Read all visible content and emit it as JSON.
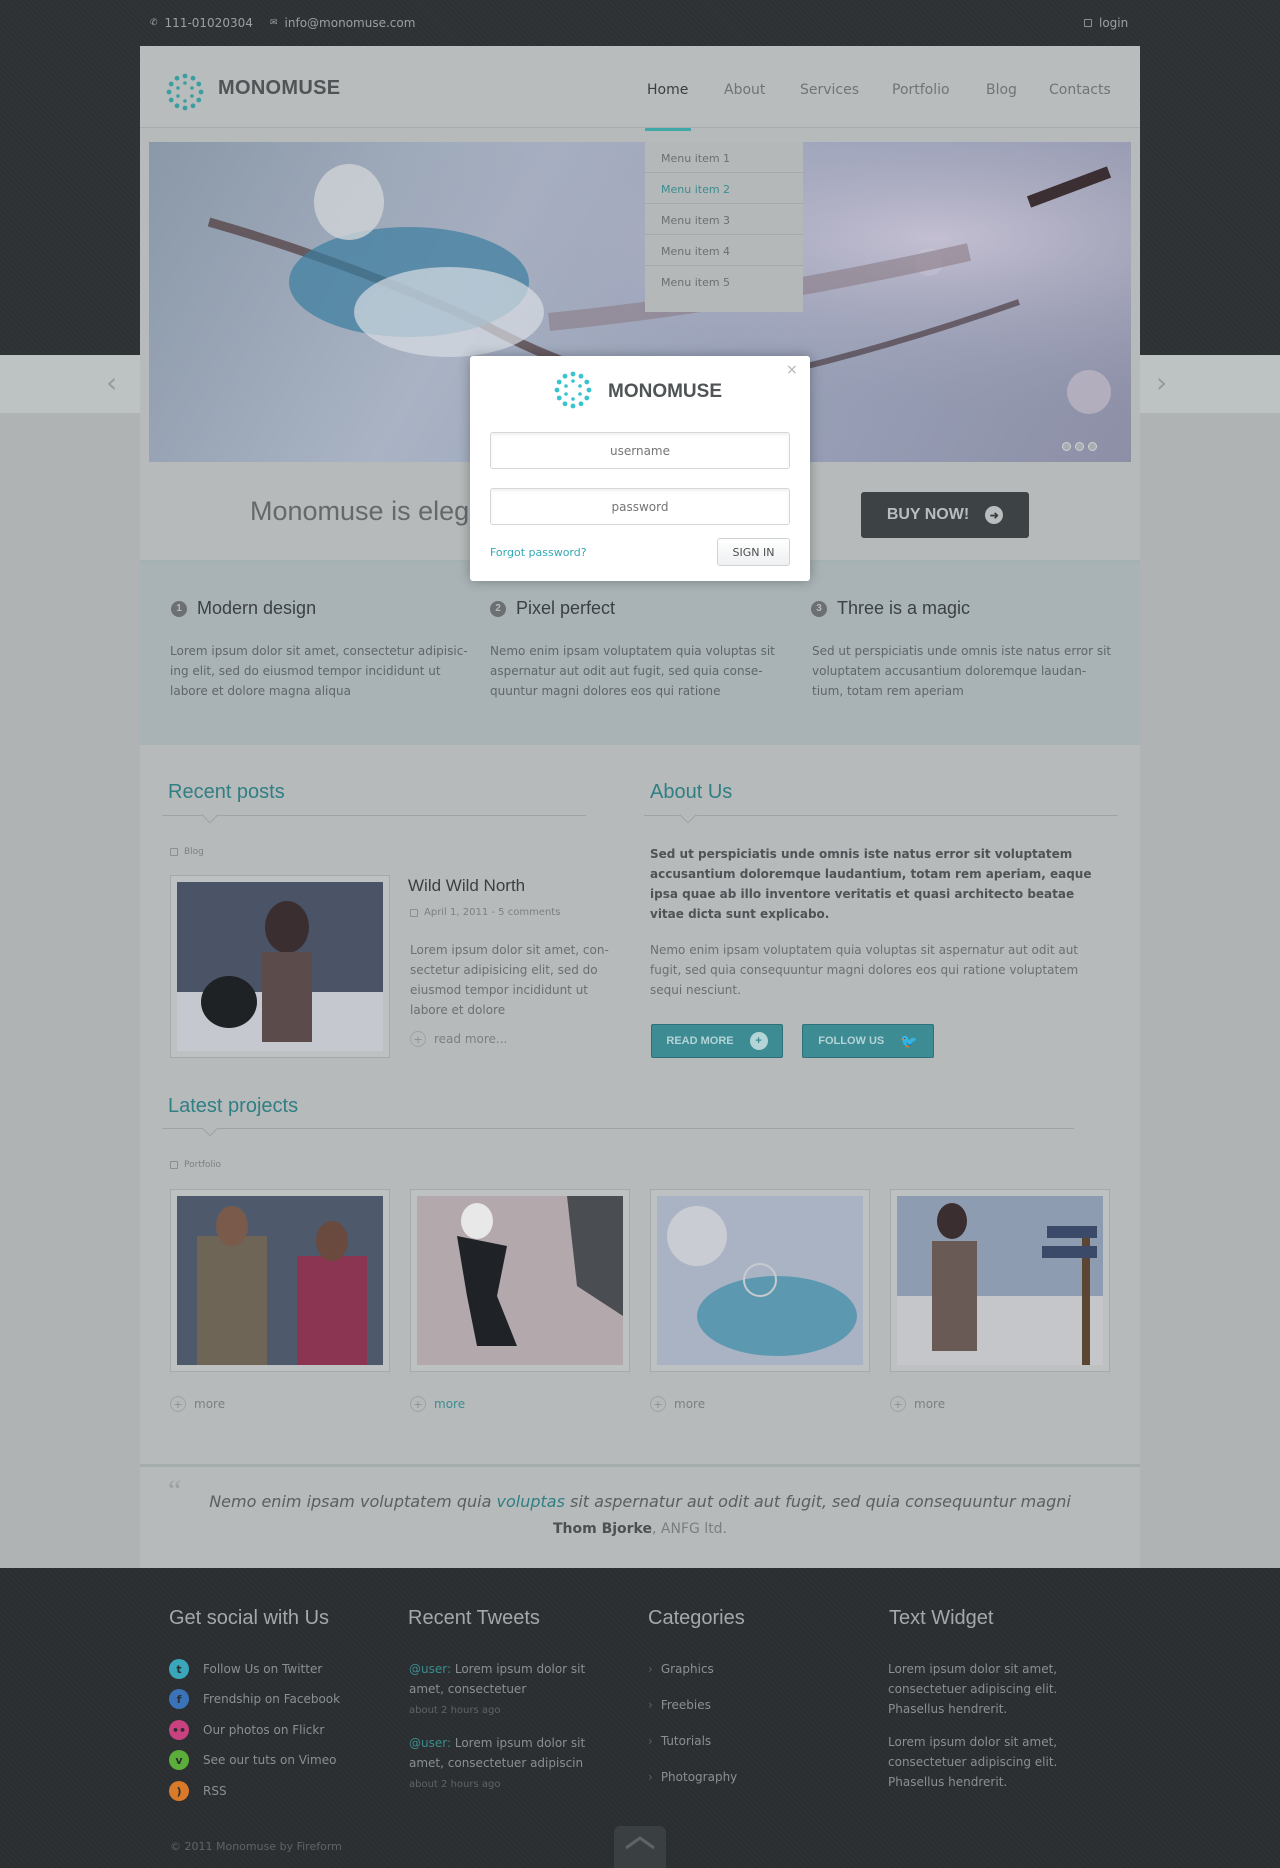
{
  "topbar": {
    "phone": "111-01020304",
    "email": "info@monomuse.com",
    "login": "login"
  },
  "brand": {
    "name": "MONOMUSE",
    "accent": "#3fa7a8"
  },
  "nav": [
    "Home",
    "About",
    "Services",
    "Portfolio",
    "Blog",
    "Contacts"
  ],
  "dropdown": [
    "Menu item 1",
    "Menu item 2",
    "Menu item 3",
    "Menu item 4",
    "Menu item 5"
  ],
  "hero": {
    "tagline": "Monomuse is eleg",
    "buy": "BUY NOW!"
  },
  "features": [
    {
      "num": "1",
      "title": "Modern design",
      "text": "Lorem ipsum dolor sit amet, consectetur adipisic-ing elit, sed do eiusmod tempor incididunt ut labore et dolore magna aliqua"
    },
    {
      "num": "2",
      "title": "Pixel perfect",
      "text": "Nemo enim ipsam voluptatem quia voluptas sit aspernatur aut odit aut fugit, sed quia conse-quuntur magni dolores eos qui ratione"
    },
    {
      "num": "3",
      "title": "Three is a magic",
      "text": "Sed ut perspiciatis unde omnis iste natus error sit voluptatem accusantium doloremque laudan-tium, totam rem aperiam"
    }
  ],
  "recent": {
    "title": "Recent posts",
    "tag": "Blog",
    "post_title": "Wild Wild North",
    "post_meta": "April 1, 2011 - 5 comments",
    "post_text": "Lorem ipsum dolor sit amet, con-sectetur adipisicing elit, sed do eiusmod tempor incididunt ut labore et dolore",
    "read_more": "read more..."
  },
  "about": {
    "title": "About Us",
    "bold": "Sed ut perspiciatis unde omnis iste natus error sit voluptatem accusantium doloremque laudantium, totam rem aperiam, eaque ipsa quae ab illo inventore veritatis et quasi architecto beatae vitae dicta sunt explicabo.",
    "text": "Nemo enim ipsam voluptatem quia voluptas sit aspernatur aut odit aut fugit, sed quia consequuntur magni dolores eos qui ratione voluptatem sequi nesciunt.",
    "read_more": "READ MORE",
    "follow": "FOLLOW US"
  },
  "projects": {
    "title": "Latest projects",
    "tag": "Portfolio",
    "more": "more"
  },
  "quote": {
    "before": "Nemo enim ipsam voluptatem quia ",
    "highlight": "voluptas",
    "after": " sit aspernatur aut odit aut fugit, sed quia consequuntur magni",
    "author": "Thom Bjorke",
    "company": ", ANFG ltd."
  },
  "footer": {
    "social_title": "Get social with Us",
    "social": [
      {
        "label": "Follow Us on Twitter",
        "icon": "twitter-icon",
        "color": "#3aa6b9"
      },
      {
        "label": "Frendship on Facebook",
        "icon": "facebook-icon",
        "color": "#3b73b8"
      },
      {
        "label": "Our photos on Flickr",
        "icon": "flickr-icon",
        "color": "#c9417f"
      },
      {
        "label": "See our tuts on Vimeo",
        "icon": "vimeo-icon",
        "color": "#5cae3b"
      },
      {
        "label": "RSS",
        "icon": "rss-icon",
        "color": "#d9792a"
      }
    ],
    "tweets_title": "Recent Tweets",
    "tweets": [
      {
        "user": "@user:",
        "text": "Lorem ipsum dolor sit amet, consectetuer",
        "ago": "about 2 hours ago"
      },
      {
        "user": "@user:",
        "text": "Lorem ipsum dolor sit amet, consectetuer adipiscin",
        "ago": "about 2 hours ago"
      }
    ],
    "categories_title": "Categories",
    "categories": [
      "Graphics",
      "Freebies",
      "Tutorials",
      "Photography"
    ],
    "widget_title": "Text Widget",
    "widget_text_1": "Lorem ipsum dolor sit amet, consectetuer adipiscing elit. Phasellus hendrerit.",
    "widget_text_2": "Lorem ipsum dolor sit amet, consectetuer adipiscing elit. Phasellus hendrerit.",
    "copyright": "© 2011 Monomuse by Fireform"
  },
  "modal": {
    "username_placeholder": "username",
    "password_placeholder": "password",
    "forgot": "Forgot password?",
    "signin": "SIGN IN",
    "close": "×"
  }
}
